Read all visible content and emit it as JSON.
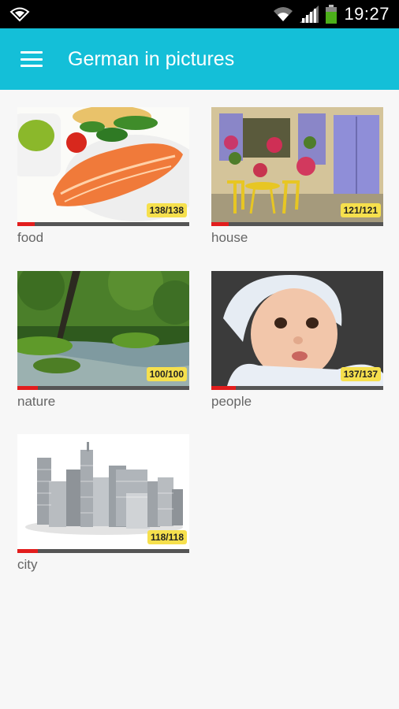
{
  "status_bar": {
    "time": "19:27"
  },
  "app_bar": {
    "title": "German in pictures",
    "menu_icon": "hamburger-menu-icon"
  },
  "categories": [
    {
      "name": "food",
      "count": "138/138",
      "progress": 0.1
    },
    {
      "name": "house",
      "count": "121/121",
      "progress": 0.1
    },
    {
      "name": "nature",
      "count": "100/100",
      "progress": 0.12
    },
    {
      "name": "people",
      "count": "137/137",
      "progress": 0.14
    },
    {
      "name": "city",
      "count": "118/118",
      "progress": 0.12
    }
  ],
  "colors": {
    "app_bar": "#14bfd8",
    "progress_fill": "#e21d1d",
    "progress_track": "#555555",
    "badge": "#f6e04d"
  }
}
